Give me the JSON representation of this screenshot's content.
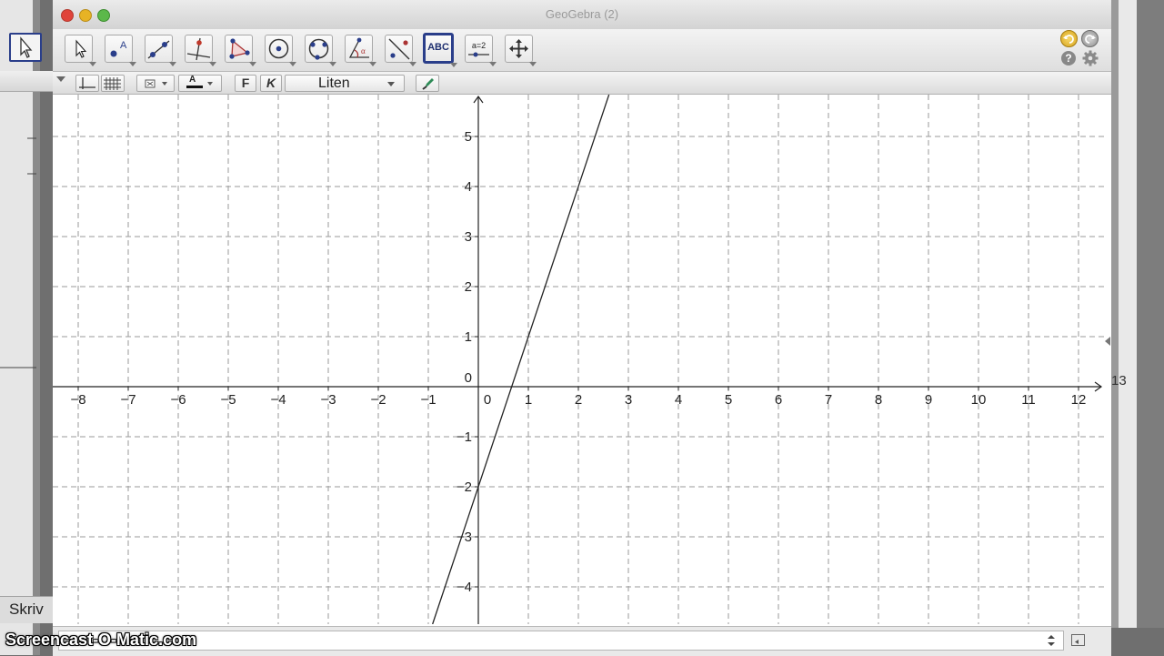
{
  "window": {
    "title": "GeoGebra (2)"
  },
  "toolbar": {
    "tools": [
      "move-tool",
      "point-tool",
      "line-tool",
      "perpendicular-line-tool",
      "polygon-tool",
      "circle-tool",
      "conic-tool",
      "angle-tool",
      "reflect-tool",
      "text-tool",
      "slider-tool",
      "move-graphics-view-tool"
    ],
    "text_tool_label": "ABC",
    "slider_tool_label": "a=2"
  },
  "stylebar": {
    "bold_label": "F",
    "italic_label": "K",
    "font_size_value": "Liten",
    "color_swatch_label": "A"
  },
  "graph": {
    "x_ticks": [
      "−8",
      "−7",
      "−6",
      "−5",
      "−4",
      "−3",
      "−2",
      "−1",
      "0",
      "1",
      "2",
      "3",
      "4",
      "5",
      "6",
      "7",
      "8",
      "9",
      "10",
      "11",
      "12"
    ],
    "y_ticks": [
      "5",
      "4",
      "3",
      "2",
      "1",
      "0",
      "−1",
      "−2",
      "−3",
      "−4"
    ],
    "line": {
      "slope": 3,
      "intercept": -2
    }
  },
  "background_window": {
    "input_label": "Skriv",
    "axis_label": "13"
  },
  "watermark": "Screencast-O-Matic.com",
  "colors": {
    "text_tool_border": "#2a3e8a",
    "grid": "#9a9a9a",
    "line": "#222222",
    "close": "#e0443a",
    "minimize": "#e7b325",
    "zoom": "#5cb84a"
  }
}
